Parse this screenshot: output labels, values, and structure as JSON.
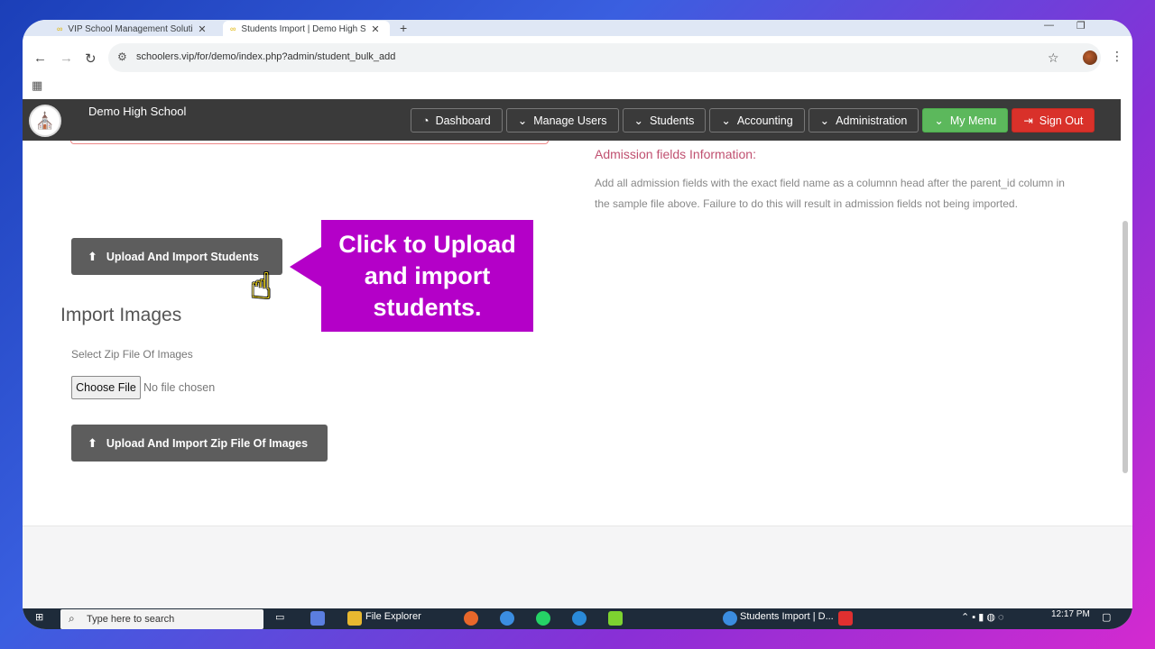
{
  "browser": {
    "tabs": [
      {
        "title": "VIP School Management Soluti",
        "active": false
      },
      {
        "title": "Students Import | Demo High S",
        "active": true
      }
    ],
    "url": "schoolers.vip/for/demo/index.php?admin/student_bulk_add"
  },
  "site": {
    "school_name": "Demo High School",
    "nav": {
      "dashboard": "Dashboard",
      "manage_users": "Manage Users",
      "students": "Students",
      "accounting": "Accounting",
      "administration": "Administration",
      "my_menu": "My Menu",
      "sign_out": "Sign Out"
    }
  },
  "content": {
    "upload_students_label": "Upload And Import Students",
    "import_images_title": "Import Images",
    "zip_label": "Select Zip File Of Images",
    "choose_file_label": "Choose File",
    "no_file_text": "No file chosen",
    "upload_zip_label": "Upload And Import Zip File Of Images",
    "admission_title": "Admission fields Information:",
    "admission_desc": "Add all admission fields with the exact field name as a columnn head after the parent_id column in the sample file above. Failure to do this will result in admission fields not being imported."
  },
  "callout": {
    "line1": "Click to Upload",
    "line2": "and import",
    "line3": "students."
  },
  "taskbar": {
    "search_placeholder": "Type here to search",
    "file_explorer": "File Explorer",
    "chrome_window": "Students Import | D...",
    "time": "12:17 PM"
  },
  "colors": {
    "nav_bg": "#3a3a3a",
    "my_menu": "#5cb85c",
    "sign_out": "#d9312a",
    "callout": "#b400c8",
    "admission_title": "#c05070"
  }
}
